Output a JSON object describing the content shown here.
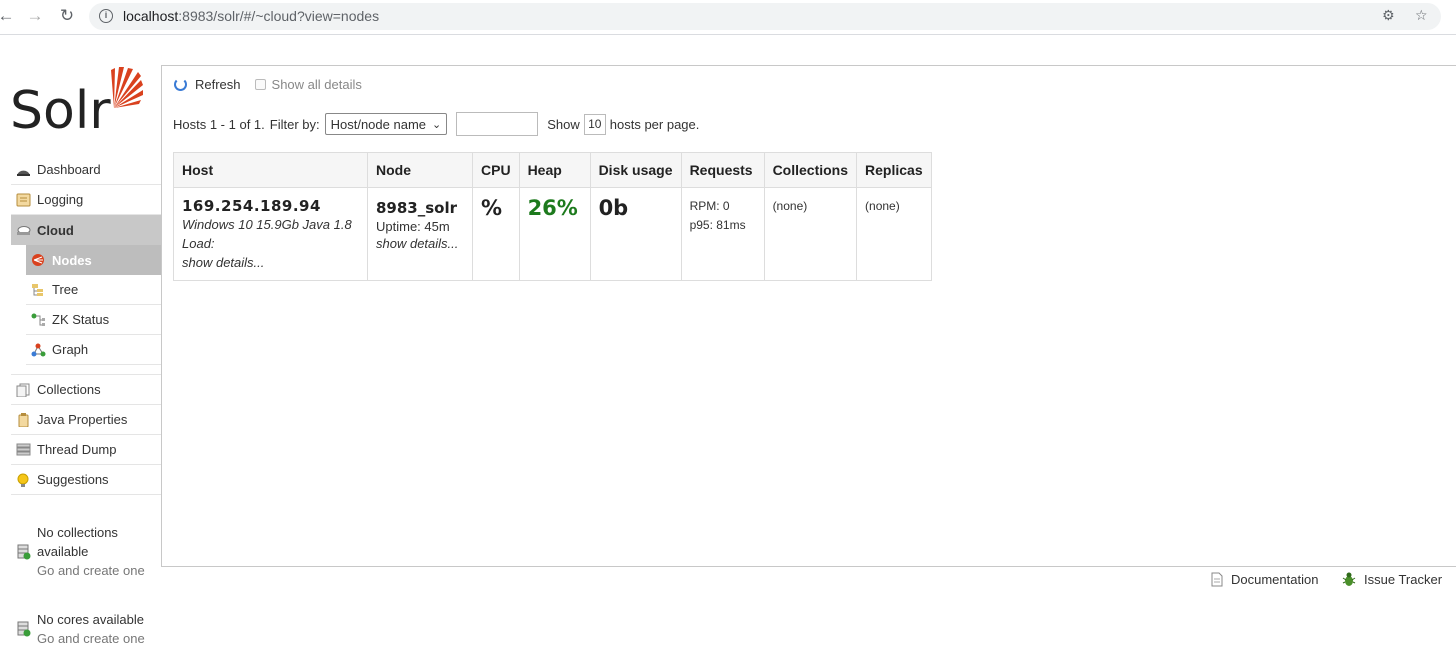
{
  "browser": {
    "url_host": "localhost",
    "url_rest": ":8983/solr/#/~cloud?view=nodes"
  },
  "logo": {
    "text": "Solr"
  },
  "sidebar": {
    "items": [
      {
        "label": "Dashboard"
      },
      {
        "label": "Logging"
      },
      {
        "label": "Cloud"
      }
    ],
    "cloud_sub": [
      {
        "label": "Nodes"
      },
      {
        "label": "Tree"
      },
      {
        "label": "ZK Status"
      },
      {
        "label": "Graph"
      }
    ],
    "items2": [
      {
        "label": "Collections"
      },
      {
        "label": "Java Properties"
      },
      {
        "label": "Thread Dump"
      },
      {
        "label": "Suggestions"
      }
    ],
    "no_collections": {
      "line1": "No collections",
      "line2": "available",
      "link": "Go and create one"
    },
    "no_cores": {
      "line1": "No cores available",
      "link": "Go and create one"
    }
  },
  "toolbar": {
    "refresh": "Refresh",
    "show_all": "Show all details"
  },
  "filter": {
    "hosts_count": "Hosts 1 - 1 of 1.",
    "filter_by": "Filter by:",
    "select_value": "Host/node name",
    "text_value": "",
    "show": "Show",
    "per_page": "10",
    "hosts_per_page": "hosts per page."
  },
  "table": {
    "headers": [
      "Host",
      "Node",
      "CPU",
      "Heap",
      "Disk usage",
      "Requests",
      "Collections",
      "Replicas"
    ],
    "row": {
      "host_ip": "169.254.189.94",
      "host_os": "Windows 10 15.9Gb Java 1.8",
      "host_load": "Load:",
      "host_details": "show details...",
      "node_name": "8983_solr",
      "node_uptime": "Uptime: 45m",
      "node_details": "show details...",
      "cpu": "%",
      "heap": "26%",
      "disk": "0b",
      "rpm": "RPM: 0",
      "p95": "p95: 81ms",
      "collections": "(none)",
      "replicas": "(none)"
    }
  },
  "footer": {
    "documentation": "Documentation",
    "issue_tracker": "Issue Tracker"
  },
  "colors": {
    "accent": "#d9411e",
    "heap_green": "#1d7a1d",
    "active_bg": "#c8c8c8"
  }
}
